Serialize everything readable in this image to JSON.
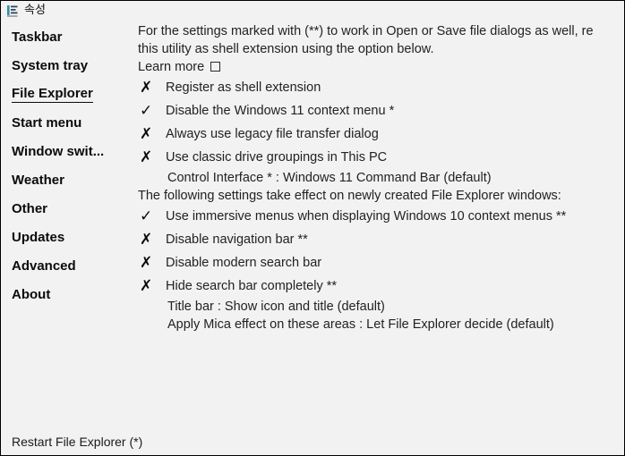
{
  "window": {
    "title": "속성",
    "icon": "properties-list-icon",
    "bg_color": "#f2f2f2",
    "border_color": "#000000",
    "text_color": "#222222"
  },
  "sidebar": {
    "items": [
      {
        "label": "Taskbar",
        "selected": false,
        "name": "sidebar-item-taskbar"
      },
      {
        "label": "System tray",
        "selected": false,
        "name": "sidebar-item-system-tray"
      },
      {
        "label": "File Explorer",
        "selected": true,
        "name": "sidebar-item-file-explorer"
      },
      {
        "label": "Start menu",
        "selected": false,
        "name": "sidebar-item-start-menu"
      },
      {
        "label": "Window swit...",
        "selected": false,
        "name": "sidebar-item-window-switcher"
      },
      {
        "label": "Weather",
        "selected": false,
        "name": "sidebar-item-weather"
      },
      {
        "label": "Other",
        "selected": false,
        "name": "sidebar-item-other"
      },
      {
        "label": "Updates",
        "selected": false,
        "name": "sidebar-item-updates"
      },
      {
        "label": "Advanced",
        "selected": false,
        "name": "sidebar-item-advanced"
      },
      {
        "label": "About",
        "selected": false,
        "name": "sidebar-item-about"
      }
    ]
  },
  "content": {
    "intro_line1": "For the settings marked with (**) to work in Open or Save file dialogs as well, re",
    "intro_line2": "this utility as shell extension using the option below.",
    "learn_more_label": "Learn more",
    "options_group1": [
      {
        "mark": "✗",
        "state": "off",
        "label": "Register as shell extension"
      },
      {
        "mark": "✓",
        "state": "on",
        "label": "Disable the Windows 11 context menu *"
      },
      {
        "mark": "✗",
        "state": "off",
        "label": "Always use legacy file transfer dialog"
      },
      {
        "mark": "✗",
        "state": "off",
        "label": "Use classic drive groupings in This PC"
      }
    ],
    "control_interface_line": "Control Interface * : Windows 11 Command Bar (default)",
    "section_note": "The following settings take effect on newly created File Explorer windows:",
    "options_group2": [
      {
        "mark": "✓",
        "state": "on",
        "label": "Use immersive menus when displaying Windows 10 context menus **"
      },
      {
        "mark": "✗",
        "state": "off",
        "label": "Disable navigation bar **"
      },
      {
        "mark": "✗",
        "state": "off",
        "label": "Disable modern search bar"
      },
      {
        "mark": "✗",
        "state": "off",
        "label": "Hide search bar completely **"
      }
    ],
    "title_bar_line": "Title bar : Show icon and title (default)",
    "mica_line": "Apply Mica effect on these areas : Let File Explorer decide (default)"
  },
  "footer": {
    "restart_label": "Restart File Explorer (*)"
  }
}
